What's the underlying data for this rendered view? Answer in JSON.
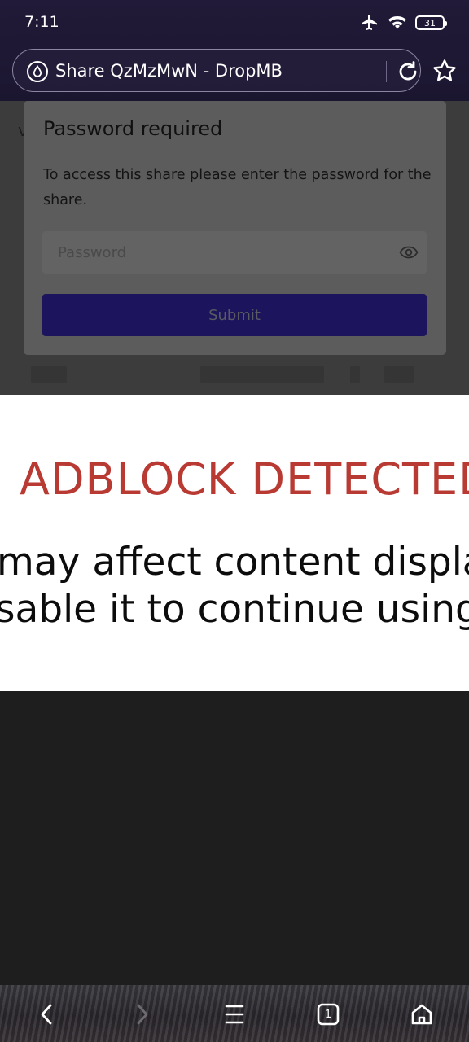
{
  "status_bar": {
    "time": "7:11",
    "battery_level": "31",
    "icons": [
      "airplane-mode-icon",
      "wifi-icon",
      "battery-icon"
    ]
  },
  "browser": {
    "page_title": "Share QzMzMwN - DropMB",
    "site_icon": "droplet-icon",
    "reload_icon": "reload-icon",
    "bookmark_icon": "star-icon"
  },
  "dialog": {
    "title": "Password required",
    "body": "To access this share please enter the password for the share.",
    "password_placeholder": "Password",
    "password_value": "",
    "submit_label": "Submit",
    "toggle_visibility_icon": "eye-icon"
  },
  "adblock": {
    "title": "ADBLOCK DETECTED",
    "line1": "may affect content display",
    "line2": "sable it to continue using",
    "title_color": "#b83a33"
  },
  "bottom_nav": {
    "tab_count": "1",
    "icons": [
      "back-icon",
      "forward-icon",
      "menu-icon",
      "tabs-icon",
      "home-icon"
    ]
  },
  "colors": {
    "submit_button": "#1c155d",
    "header_bg": "#211a38"
  }
}
